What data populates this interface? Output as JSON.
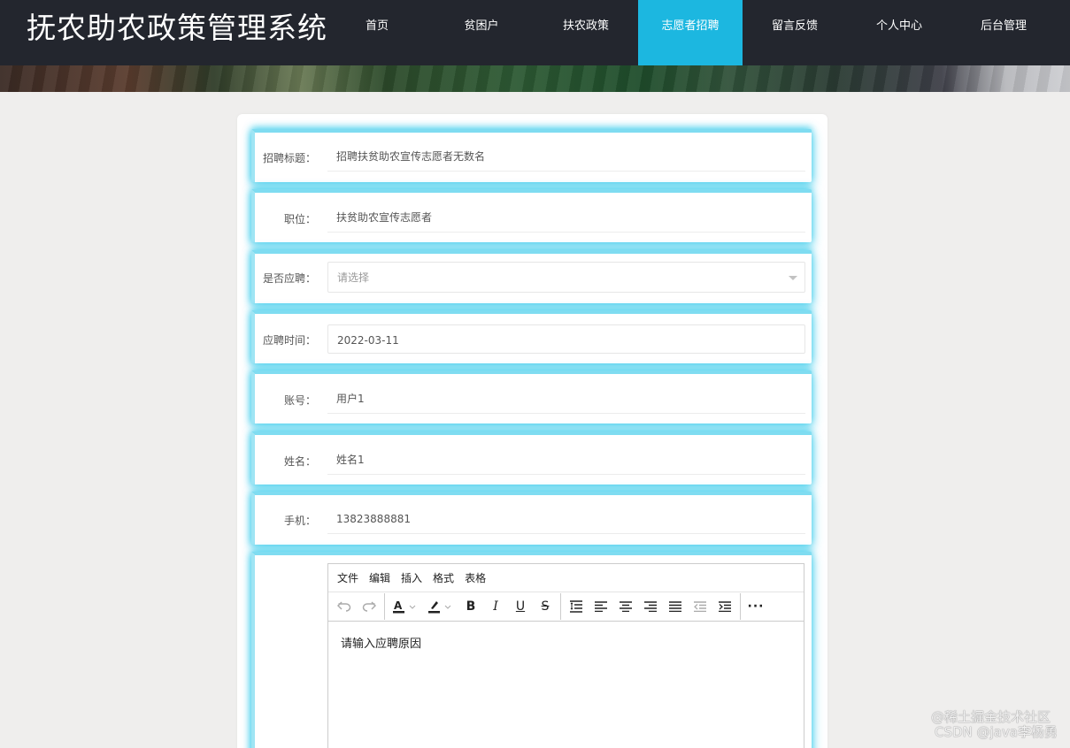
{
  "header": {
    "title": "抚农助农政策管理系统",
    "nav": [
      {
        "label": "首页",
        "name": "nav-home",
        "active": false
      },
      {
        "label": "贫困户",
        "name": "nav-poor-households",
        "active": false
      },
      {
        "label": "扶农政策",
        "name": "nav-farm-policy",
        "active": false
      },
      {
        "label": "志愿者招聘",
        "name": "nav-volunteer-recruit",
        "active": true
      },
      {
        "label": "留言反馈",
        "name": "nav-feedback",
        "active": false
      },
      {
        "label": "个人中心",
        "name": "nav-personal-center",
        "active": false
      },
      {
        "label": "后台管理",
        "name": "nav-admin",
        "active": false
      }
    ]
  },
  "form": {
    "fields": [
      {
        "label": "招聘标题：",
        "value": "招聘扶贫助农宣传志愿者无数名"
      },
      {
        "label": "职位：",
        "value": "扶贫助农宣传志愿者"
      },
      {
        "label": "是否应聘：",
        "placeholder": "请选择"
      },
      {
        "label": "应聘时间：",
        "value": "2022-03-11"
      },
      {
        "label": "账号：",
        "value": "用户1"
      },
      {
        "label": "姓名：",
        "value": "姓名1"
      },
      {
        "label": "手机：",
        "value": "13823888881"
      }
    ]
  },
  "editor": {
    "menu": [
      "文件",
      "编辑",
      "插入",
      "格式",
      "表格"
    ],
    "placeholder": "请输入应聘原因"
  },
  "watermark": {
    "line1": "@稀土掘金技术社区",
    "line2": "CSDN @java李杨勇"
  }
}
